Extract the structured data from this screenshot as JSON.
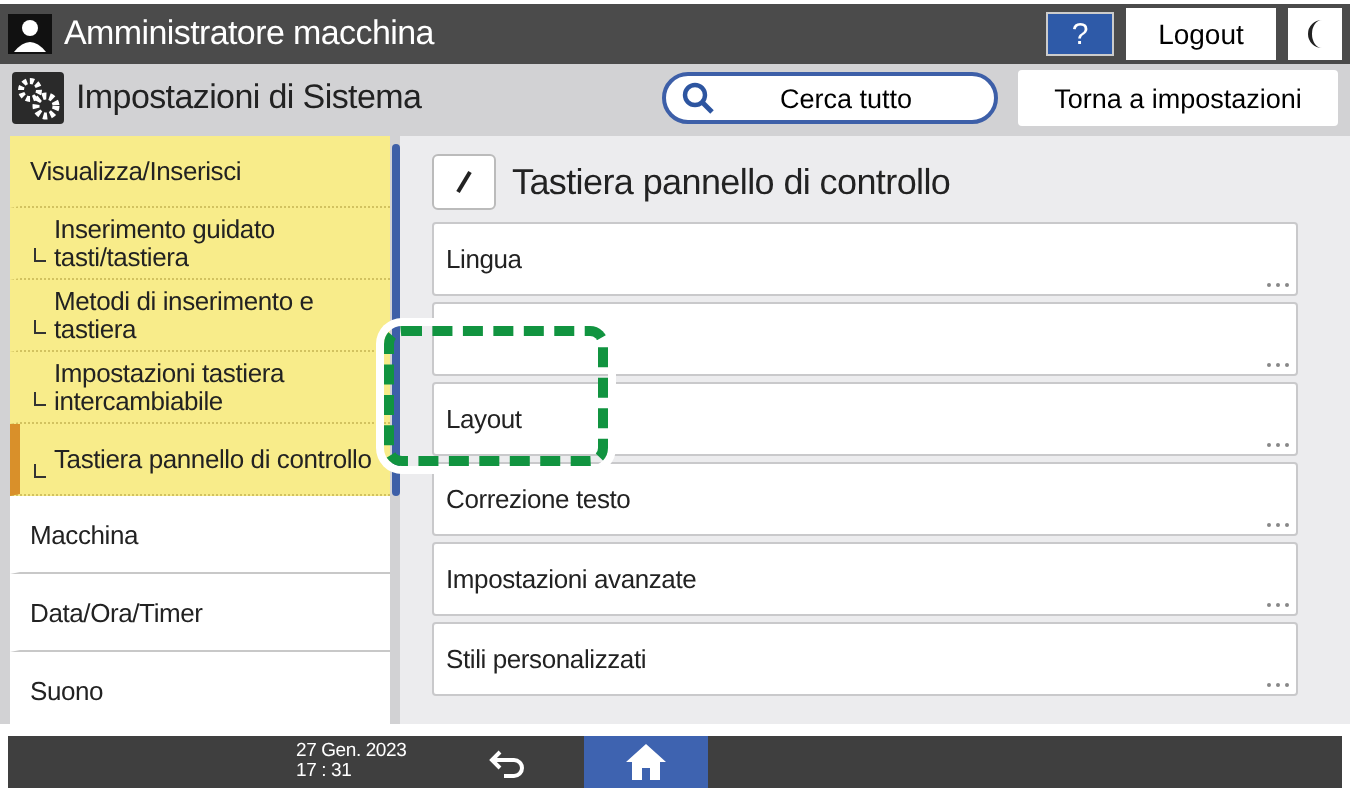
{
  "header": {
    "user": "Amministratore macchina",
    "help": "?",
    "logout": "Logout"
  },
  "toolbar": {
    "title": "Impostazioni di Sistema",
    "search": "Cerca tutto",
    "back_to_settings": "Torna a impostazioni"
  },
  "sidebar": {
    "items": [
      {
        "label": "Visualizza/Inserisci",
        "expanded": true,
        "children": [
          {
            "label": "Inserimento guidato tasti/tastiera",
            "selected": false
          },
          {
            "label": "Metodi di inserimento e tastiera",
            "selected": false
          },
          {
            "label": "Impostazioni tastiera intercambiabile",
            "selected": false
          },
          {
            "label": "Tastiera pannello di controllo",
            "selected": true
          }
        ]
      },
      {
        "label": "Macchina",
        "expanded": false
      },
      {
        "label": "Data/Ora/Timer",
        "expanded": false
      },
      {
        "label": "Suono",
        "expanded": false
      }
    ]
  },
  "content": {
    "title": "Tastiera pannello di controllo",
    "items": [
      {
        "kind": "option",
        "label": "Lingua"
      },
      {
        "kind": "covered"
      },
      {
        "kind": "option",
        "label": "Layout"
      },
      {
        "kind": "option",
        "label": "Correzione testo"
      },
      {
        "kind": "option",
        "label": "Impostazioni avanzate"
      },
      {
        "kind": "option",
        "label": "Stili personalizzati"
      }
    ]
  },
  "status_bar": {
    "date": "27 Gen. 2023",
    "time": "17 : 31"
  }
}
